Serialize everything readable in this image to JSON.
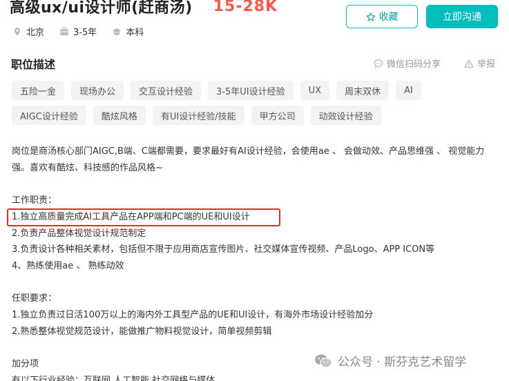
{
  "header": {
    "title": "高级ux/ui设计师(赶商汤)",
    "salary": "15-28K"
  },
  "actions": {
    "collect_label": "收藏",
    "chat_label": "立即沟通"
  },
  "meta": {
    "location": "北京",
    "experience": "3-5年",
    "education": "本科"
  },
  "section": {
    "title": "职位描述",
    "share_label": "微信扫码分享",
    "report_label": "举报"
  },
  "tags": [
    "五险一金",
    "现场办公",
    "交互设计经验",
    "3-5年UI设计经验",
    "UX",
    "周末双休",
    "AI",
    "AIGC设计经验",
    "酷炫风格",
    "有UI设计经验/技能",
    "甲方公司",
    "动效设计经验"
  ],
  "description": {
    "intro": "岗位是商汤核心部门AIGC,B端、C端都需要，要求最好有AI设计经验，会使用ae 、 会做动效、产品思维强 、 视觉能力强。喜欢有酷炫、科技感的作品风格~",
    "duties_title": "工作职责：",
    "duties": [
      "1.独立高质量完成AI工具产品在APP端和PC端的UE和UI设计",
      "2.负责产品整体视觉设计规范制定",
      "3.负责设计各种相关素材，包括但不限于应用商店宣传图片、社交媒体宣传视频、产品Logo、APP ICON等",
      "4、熟练使用ae 、 熟练动效"
    ],
    "requirements_title": "任职要求：",
    "requirements": [
      "1.独立负责过日活100万以上的海内外工具型产品的UE和UI设计，有海外市场设计经验加分",
      "2.熟悉整体视觉规范设计，能做推广物料视觉设计，简单视频剪辑"
    ],
    "bonus_title": "加分项",
    "bonus_line": "有以下行业经验：互联网 人工智能 社交网络与媒体"
  },
  "watermark": {
    "text": "公众号 · 斯芬克艺术留学"
  },
  "colors": {
    "accent": "#00bebd",
    "salary": "#fe574a",
    "highlight": "#e32b2b"
  }
}
